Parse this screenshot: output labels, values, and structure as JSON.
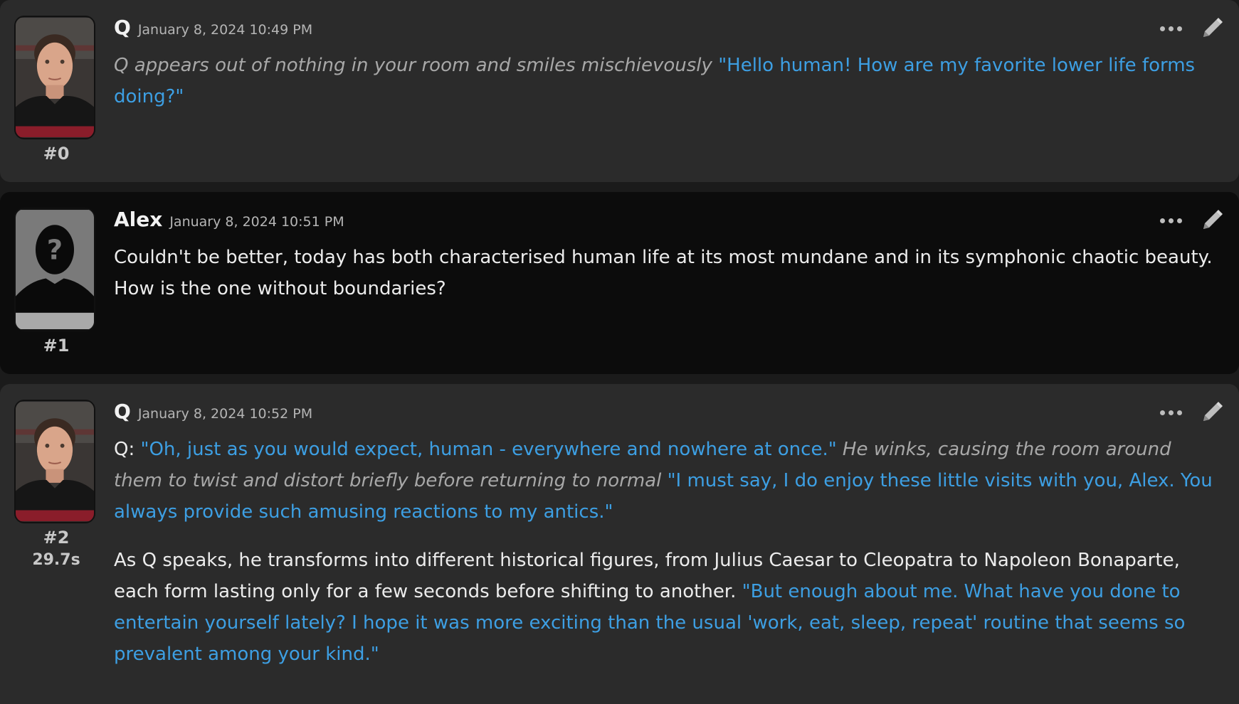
{
  "messages": [
    {
      "id_label": "#0",
      "name": "Q",
      "time": "January 8, 2024 10:49 PM",
      "timer": "",
      "paragraphs": [
        [
          {
            "style": "italic",
            "text": "Q appears out of nothing in your room and smiles mischievously "
          },
          {
            "style": "quote",
            "text": "\"Hello human! How are my favorite lower life forms doing?\""
          }
        ]
      ]
    },
    {
      "id_label": "#1",
      "name": "Alex",
      "time": "January 8, 2024 10:51 PM",
      "timer": "",
      "paragraphs": [
        [
          {
            "style": "plain",
            "text": "Couldn't be better, today has both characterised human life at its most mundane and in its symphonic chaotic beauty. How is the one without boundaries?"
          }
        ]
      ]
    },
    {
      "id_label": "#2",
      "name": "Q",
      "time": "January 8, 2024 10:52 PM",
      "timer": "29.7s",
      "paragraphs": [
        [
          {
            "style": "plain",
            "text": "Q: "
          },
          {
            "style": "quote",
            "text": "\"Oh, just as you would expect, human - everywhere and nowhere at once.\""
          },
          {
            "style": "italic",
            "text": " He winks, causing the room around them to twist and distort briefly before returning to normal "
          },
          {
            "style": "quote",
            "text": "\"I must say, I do enjoy these little visits with you, Alex. You always provide such amusing reactions to my antics.\""
          }
        ],
        [
          {
            "style": "plain",
            "text": "As Q speaks, he transforms into different historical figures, from Julius Caesar to Cleopatra to Napoleon Bonaparte, each form lasting only for a few seconds before shifting to another. "
          },
          {
            "style": "quote",
            "text": "\"But enough about me. What have you done to entertain yourself lately? I hope it was more exciting than the usual 'work, eat, sleep, repeat' routine that seems so prevalent among your kind.\""
          }
        ]
      ]
    }
  ],
  "icons": {
    "more": "more-options-icon",
    "edit": "pencil-icon"
  },
  "colors": {
    "quote": "#3d9fe3",
    "narration": "#a8a8a8",
    "char_bg": "#2b2b2b",
    "user_bg": "#0c0c0c"
  }
}
